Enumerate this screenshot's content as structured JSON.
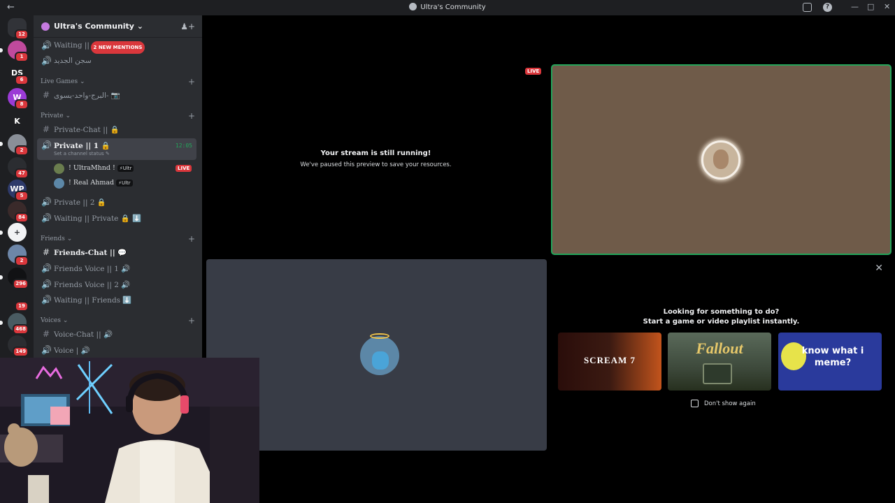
{
  "window": {
    "title": "Ultra's Community"
  },
  "rail": {
    "servers": [
      {
        "name": "direct-messages",
        "glyph": "",
        "color": "#313338",
        "badge": "12"
      },
      {
        "name": "server-1",
        "glyph": "",
        "color": "#c04a9c",
        "badge": "1"
      },
      {
        "name": "server-ds",
        "glyph": "DS",
        "color": "#1e1f22",
        "badge": "6"
      },
      {
        "name": "server-w",
        "glyph": "W",
        "color": "#9b3bd6",
        "badge": "8"
      },
      {
        "name": "server-k",
        "glyph": "K",
        "color": "#1e1f22",
        "badge": ""
      },
      {
        "name": "server-5",
        "glyph": "",
        "color": "#8a8f98",
        "badge": "2"
      },
      {
        "name": "server-6",
        "glyph": "",
        "color": "#2b2d31",
        "badge": "47"
      },
      {
        "name": "server-wp",
        "glyph": "WP",
        "color": "#2e3a6a",
        "badge": "5"
      },
      {
        "name": "server-8",
        "glyph": "",
        "color": "#3a2a2a",
        "badge": "84"
      },
      {
        "name": "server-9",
        "glyph": "+",
        "color": "#f2f3f5",
        "badge": ""
      },
      {
        "name": "server-10",
        "glyph": "",
        "color": "#6d86a8",
        "badge": "2"
      },
      {
        "name": "server-11",
        "glyph": "",
        "color": "#111214",
        "badge": "296"
      },
      {
        "name": "server-12",
        "glyph": "",
        "color": "#1e1f22",
        "badge": "19"
      },
      {
        "name": "server-13",
        "glyph": "",
        "color": "#4a5b62",
        "badge": "468"
      },
      {
        "name": "server-14",
        "glyph": "",
        "color": "#2b2d31",
        "badge": "149"
      }
    ]
  },
  "sidebar": {
    "server_name": "Ultra's Community",
    "mentions_pill": "2 NEW MENTIONS",
    "top_channels": [
      {
        "label": "Waiting || …"
      },
      {
        "label": "سجن الجديد"
      }
    ],
    "categories": {
      "live_games": "Live Games",
      "private": "Private",
      "friends": "Friends",
      "voices": "Voices"
    },
    "live_games_channel": "البرج-واحد-يسوى- 📷",
    "private_channels": [
      {
        "label": "Private-Chat || 🔒"
      },
      {
        "label": "Private || 1 🔒",
        "status": "Set a channel status",
        "time": "12:05"
      },
      {
        "label": "Private || 2 🔒"
      },
      {
        "label": "Waiting || Private 🔒 ⬇️"
      }
    ],
    "voice_users": [
      {
        "name": "! UltraMhnd !",
        "tag": "⚡Ultr",
        "live": "LIVE"
      },
      {
        "name": "! Real Ahmad",
        "tag": "⚡Ultr"
      }
    ],
    "friends_channels": [
      {
        "label": "Friends-Chat || 💬"
      },
      {
        "label": "Friends Voice || 1 🔊"
      },
      {
        "label": "Friends Voice || 2 🔊"
      },
      {
        "label": "Waiting || Friends ⬇️"
      }
    ],
    "voices_channels": [
      {
        "label": "Voice-Chat || 🔊"
      },
      {
        "label": "Voice | 🔊"
      }
    ]
  },
  "stage": {
    "live_label": "LIVE",
    "paused_title": "Your stream is still running!",
    "paused_sub": "We've paused this preview to save your resources."
  },
  "activity": {
    "heading_1": "Looking for something to do?",
    "heading_2": "Start a game or video playlist instantly.",
    "games": [
      {
        "name": "SCREAM 7"
      },
      {
        "name": "Fallout"
      },
      {
        "name": "know what i meme?"
      }
    ],
    "dont_show": "Don't show again"
  },
  "colors": {
    "accent_green": "#23a55a",
    "live_red": "#da373c",
    "sidebar_bg": "#2b2d31",
    "rail_bg": "#1e1f22"
  }
}
